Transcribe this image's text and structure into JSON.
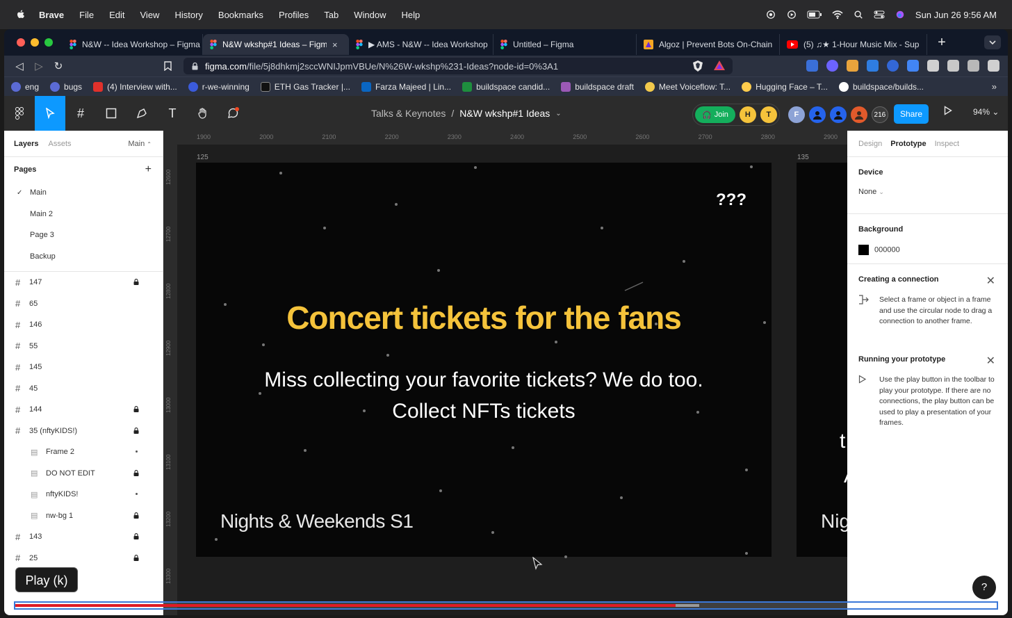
{
  "menubar": {
    "app": "Brave",
    "items": [
      "File",
      "Edit",
      "View",
      "History",
      "Bookmarks",
      "Profiles",
      "Tab",
      "Window",
      "Help"
    ],
    "clock": "Sun Jun 26  9:56 AM"
  },
  "tabs": [
    {
      "title": "N&W -- Idea Workshop – Figma"
    },
    {
      "title": "N&W wkshp#1 Ideas – Figma",
      "close": "×"
    },
    {
      "title": "▶ AMS - N&W -- Idea Workshop"
    },
    {
      "title": "Untitled – Figma"
    },
    {
      "title": "Algoz | Prevent Bots On-Chain"
    },
    {
      "title": "(5) ♫★ 1-Hour Music Mix - Sup"
    }
  ],
  "newtab": "+",
  "address": {
    "domain": "figma.com",
    "path": "/file/5j8dhkmj2sccWNIJpmVBUe/N%26W-wkshp%231-Ideas?node-id=0%3A1"
  },
  "bookmarks": [
    {
      "label": "eng",
      "color": "#5b6bd5"
    },
    {
      "label": "bugs",
      "color": "#5b6bd5"
    },
    {
      "label": "(4) Interview with...",
      "color": "#e0312b"
    },
    {
      "label": "r-we-winning",
      "color": "#3b5bdb"
    },
    {
      "label": "ETH Gas Tracker |...",
      "color": "#111111"
    },
    {
      "label": "Farza Majeed | Lin...",
      "color": "#0a66c2"
    },
    {
      "label": "buildspace candid...",
      "color": "#1e8e3e"
    },
    {
      "label": "buildspace draft",
      "color": "#9b59b6"
    },
    {
      "label": "Meet Voiceflow: T...",
      "color": "#f2c94c"
    },
    {
      "label": "Hugging Face – T...",
      "color": "#ffcc4d"
    },
    {
      "label": "buildspace/builds...",
      "color": "#ffffff"
    }
  ],
  "figma": {
    "breadcrumb_project": "Talks & Keynotes",
    "breadcrumb_sep": "/",
    "breadcrumb_file": "N&W wkshp#1 Ideas",
    "join": "Join",
    "avatars": [
      "H",
      "T",
      "F"
    ],
    "avatar_count": "216",
    "share": "Share",
    "zoom": "94%"
  },
  "left": {
    "tab_layers": "Layers",
    "tab_assets": "Assets",
    "page_selector": "Main",
    "pages_header": "Pages",
    "pages": [
      "Main",
      "Main 2",
      "Page 3",
      "Backup"
    ],
    "layers": [
      {
        "name": "147",
        "locked": true
      },
      {
        "name": "65"
      },
      {
        "name": "146"
      },
      {
        "name": "55"
      },
      {
        "name": "145"
      },
      {
        "name": "45"
      },
      {
        "name": "144",
        "locked": true
      },
      {
        "name": "35 (nftyKIDS!)",
        "locked": true
      },
      {
        "name": "Frame 2",
        "child": true,
        "dot": true
      },
      {
        "name": "DO NOT EDIT",
        "child": true,
        "locked": true
      },
      {
        "name": "nftyKIDS!",
        "child": true,
        "dot": true
      },
      {
        "name": "nw-bg 1",
        "child": true,
        "locked": true
      },
      {
        "name": "143",
        "locked": true
      },
      {
        "name": "25",
        "locked": true
      }
    ]
  },
  "canvas": {
    "ruler_x": [
      "1900",
      "2000",
      "2100",
      "2200",
      "2300",
      "2400",
      "2500",
      "2600",
      "2700",
      "2800",
      "2900"
    ],
    "ruler_y": [
      "12600",
      "12700",
      "12800",
      "12900",
      "13000",
      "13100",
      "13200",
      "13300"
    ],
    "frame_label_a": "125",
    "frame_label_b": "135",
    "qq": "???",
    "headline": "Concert tickets for the fans",
    "subline": "Miss collecting your favorite  tickets? We do too. Collect NFTs tickets",
    "brand": "Nights & Weekends S1",
    "frame_b_t": "t",
    "frame_b_a": "A",
    "frame_b_brand": "Nig"
  },
  "right": {
    "tab_design": "Design",
    "tab_prototype": "Prototype",
    "tab_inspect": "Inspect",
    "device_h": "Device",
    "device_val": "None",
    "bg_h": "Background",
    "bg_val": "000000",
    "conn_h": "Creating a connection",
    "conn_tx": "Select a frame or object in a frame and use the circular node to drag a connection to another frame.",
    "run_h": "Running your prototype",
    "run_tx": "Use the play button in the toolbar to play your prototype. If there are no connections, the play button can be used to play a presentation of your frames.",
    "help": "?"
  },
  "video": {
    "tooltip": "Play (k)",
    "progress": 0.673,
    "buffered": 0.697
  }
}
